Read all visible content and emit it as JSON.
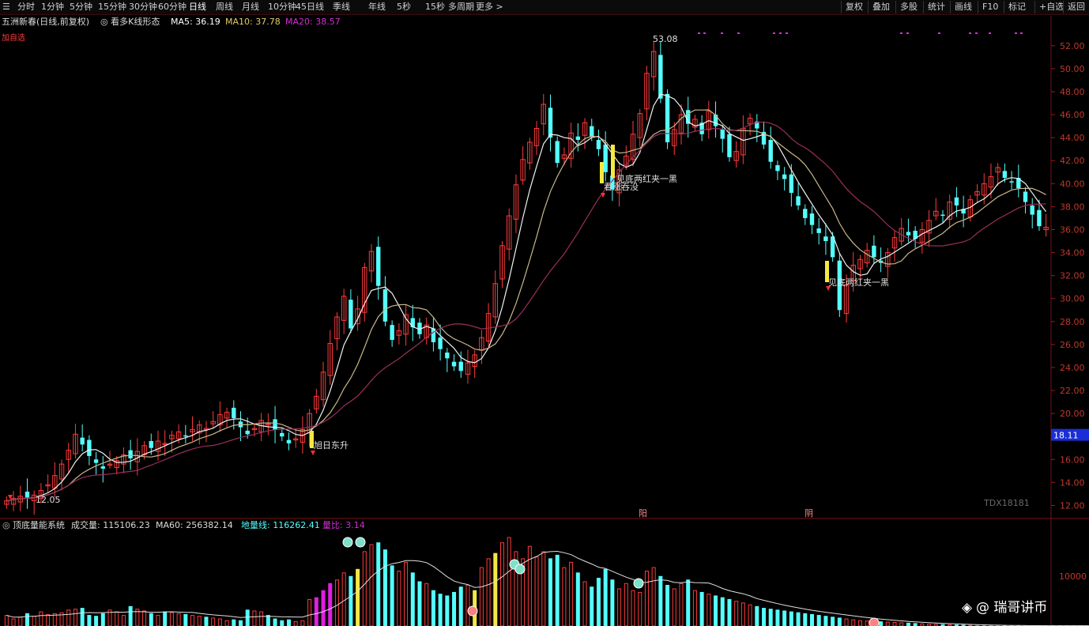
{
  "toolbar": {
    "left_icon": "☰",
    "periods": [
      "分时",
      "1分钟",
      "5分钟",
      "15分钟",
      "30分钟",
      "60分钟",
      "日线",
      "周线",
      "月线",
      "10分钟",
      "45日线",
      "季线",
      "年线",
      "5秒",
      "15秒",
      "多周期",
      "更多 >"
    ],
    "active_period": "日线",
    "right_buttons": [
      "复权",
      "叠加",
      "多股",
      "统计",
      "画线",
      "F10",
      "标记",
      "+自选",
      "返回"
    ]
  },
  "info": {
    "stock": "五洲新春(日线,前复权)",
    "indicator": "看多K线形态",
    "ma5": "MA5: 36.19",
    "ma10": "MA10: 37.78",
    "ma20": "MA20: 38.57",
    "mark": "加自选"
  },
  "labels": {
    "high": "53.08",
    "low": "12.05",
    "sig1": "旭日东升",
    "sig2": "见底两红夹一黑",
    "sig3": "见底两红夹一黑",
    "sig4": "看涨吞没",
    "tdx": "TDX18181",
    "current_price": "18.11",
    "marker1": "阳",
    "marker2": "阴"
  },
  "vol_info": {
    "title": "顶底量能系统",
    "vol": "成交量: 115106.23",
    "ma60": "MA60: 256382.14",
    "base": "地量线: 116262.41",
    "ratio": "量比: 3.14"
  },
  "watermark": "@ 瑞哥讲币",
  "colors": {
    "up": "#ff3b3b",
    "down": "#54ffff",
    "ma5": "#ffffff",
    "ma10": "#e6c96a",
    "ma20": "#d22fd2",
    "grid": "#5a0d0d",
    "price_label": "#1a2dd6"
  },
  "chart_data": {
    "type": "candlestick",
    "y_ticks": [
      52,
      50,
      48,
      46,
      44,
      42,
      40,
      38,
      36,
      34,
      32,
      30,
      28,
      26,
      24,
      22,
      20,
      18,
      16,
      14,
      12
    ],
    "y_axis_labels": [
      "52.00",
      "50.00",
      "48.00",
      "46.00",
      "44.00",
      "42.00",
      "40.00",
      "38.00",
      "36.00",
      "34.00",
      "32.00",
      "30.00",
      "28.00",
      "26.00",
      "24.00",
      "22.00",
      "20.00",
      "18.00",
      "16.00",
      "14.00",
      "12.00"
    ],
    "ylim": [
      11,
      53.5
    ],
    "vol_tick": "10000",
    "closes": [
      12.4,
      12.6,
      12.8,
      12.7,
      12.9,
      13.3,
      13.8,
      14.6,
      15.6,
      16.8,
      18.2,
      17.3,
      16.3,
      15.7,
      15.2,
      15.6,
      15.9,
      16.4,
      16.1,
      16.7,
      17.2,
      17.0,
      17.6,
      17.4,
      18.1,
      18.4,
      18.0,
      18.6,
      19.0,
      18.7,
      19.3,
      19.9,
      20.1,
      19.6,
      18.8,
      18.2,
      18.7,
      19.4,
      19.1,
      18.6,
      18.0,
      17.4,
      17.8,
      18.6,
      20.0,
      21.5,
      23.6,
      26.1,
      28.4,
      30.2,
      27.4,
      29.1,
      32.7,
      34.1,
      31.1,
      28.0,
      26.4,
      27.2,
      28.6,
      27.5,
      26.9,
      27.7,
      26.2,
      25.6,
      24.8,
      24.1,
      23.7,
      24.4,
      25.1,
      26.6,
      28.7,
      31.3,
      34.6,
      37.2,
      39.9,
      42.1,
      43.6,
      44.8,
      46.9,
      44.0,
      41.8,
      42.5,
      44.4,
      43.8,
      45.3,
      44.1,
      43.0,
      41.0,
      39.5,
      41.2,
      42.4,
      44.3,
      46.1,
      49.6,
      51.5,
      47.4,
      43.6,
      44.7,
      46.0,
      45.2,
      45.6,
      44.3,
      46.3,
      45.0,
      43.9,
      42.3,
      42.8,
      44.8,
      45.7,
      44.8,
      43.4,
      41.9,
      41.1,
      40.4,
      39.2,
      38.1,
      37.0,
      36.4,
      35.7,
      35.0,
      33.6,
      29.0,
      31.2,
      32.9,
      33.4,
      34.2,
      33.6,
      33.1,
      34.0,
      35.3,
      36.1,
      35.5,
      35.2,
      36.0,
      36.8,
      37.6,
      37.2,
      38.4,
      38.1,
      37.4,
      38.6,
      39.3,
      40.0,
      40.6,
      41.4,
      40.5,
      40.1,
      39.6,
      38.4,
      37.3,
      36.3,
      36.2
    ],
    "vol_values": [
      60,
      40,
      50,
      70,
      55,
      80,
      65,
      70,
      75,
      90,
      95,
      100,
      60,
      55,
      70,
      90,
      80,
      60,
      110,
      95,
      85,
      70,
      60,
      80,
      75,
      70,
      65,
      60,
      55,
      50,
      45,
      40,
      30,
      35,
      30,
      90,
      85,
      80,
      60,
      40,
      30,
      35,
      25,
      30,
      150,
      160,
      200,
      240,
      260,
      300,
      280,
      320,
      420,
      460,
      470,
      430,
      340,
      310,
      360,
      300,
      250,
      240,
      200,
      180,
      170,
      190,
      220,
      230,
      200,
      330,
      380,
      410,
      470,
      500,
      420,
      380,
      450,
      390,
      420,
      380,
      400,
      330,
      360,
      300,
      250,
      220,
      270,
      320,
      260,
      210,
      240,
      200,
      190,
      310,
      330,
      280,
      230,
      210,
      240,
      260,
      200,
      190,
      180,
      170,
      160,
      150,
      140,
      130,
      120,
      110,
      100,
      95,
      90,
      85,
      80,
      75,
      70,
      65,
      60,
      55,
      50,
      45,
      40,
      35,
      30,
      28,
      26,
      24,
      22,
      20,
      18,
      16,
      14,
      12,
      10,
      9,
      8,
      7,
      6,
      5,
      4,
      3,
      2,
      2,
      2,
      2,
      2,
      2,
      2,
      2,
      2,
      2,
      2,
      2,
      2,
      2,
      2,
      2
    ]
  }
}
